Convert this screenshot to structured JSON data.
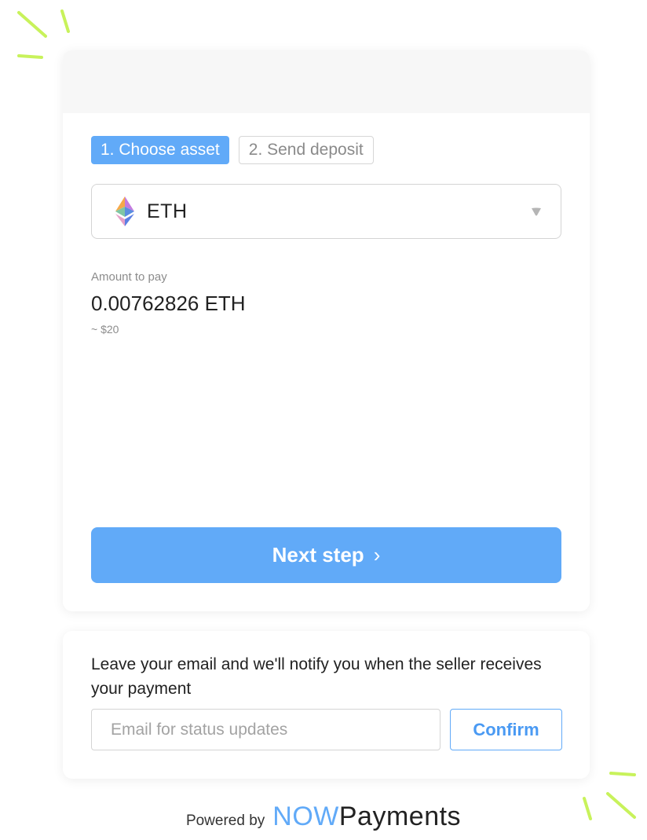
{
  "colors": {
    "accent": "#61aaf8",
    "decoration": "#c8f25b",
    "muted_text": "#8c8c8c"
  },
  "steps": [
    {
      "label": "1. Choose asset",
      "active": true
    },
    {
      "label": "2. Send deposit",
      "active": false
    }
  ],
  "asset_select": {
    "icon": "ethereum-logo-icon",
    "selected": "ETH",
    "caret_icon": "caret-down-icon"
  },
  "amount": {
    "label": "Amount to pay",
    "value": "0.00762826 ETH",
    "fiat": "~ $20"
  },
  "next_button": {
    "label": "Next step",
    "chevron": "›"
  },
  "email_section": {
    "text": "Leave your email and we'll notify you when the seller receives your payment",
    "input_value": "",
    "input_placeholder": "Email for status updates",
    "confirm_label": "Confirm"
  },
  "footer": {
    "powered_by": "Powered by",
    "brand_part1": "NOW",
    "brand_part2": "Payments"
  }
}
